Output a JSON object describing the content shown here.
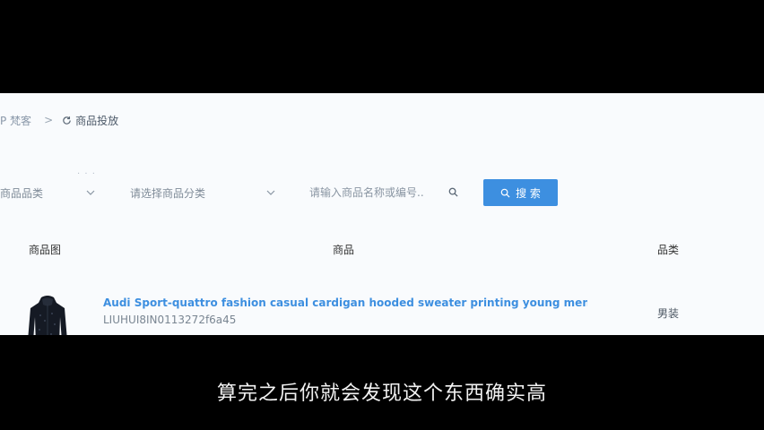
{
  "breadcrumb": {
    "prefix": "P 梵客",
    "separator": ">",
    "current": "商品投放"
  },
  "decor": {
    "dots": ". . ."
  },
  "filters": {
    "category_select": "商品品类",
    "classification_select": "请选择商品分类",
    "search_placeholder": "请输入商品名称或编号..",
    "search_button": "搜 索"
  },
  "table": {
    "headers": {
      "image": "商品图",
      "product": "商品",
      "category": "品类"
    },
    "rows": [
      {
        "title": "Audi Sport-quattro fashion casual cardigan hooded sweater printing young men's ...",
        "sku": "LIUHUI8IN0113272f6a45",
        "category": "男装"
      }
    ]
  },
  "subtitle": "算完之后你就会发现这个东西确实高",
  "colors": {
    "accent": "#3d8fe0",
    "page_bg": "#f9fbfd",
    "letterbox": "#000000"
  }
}
